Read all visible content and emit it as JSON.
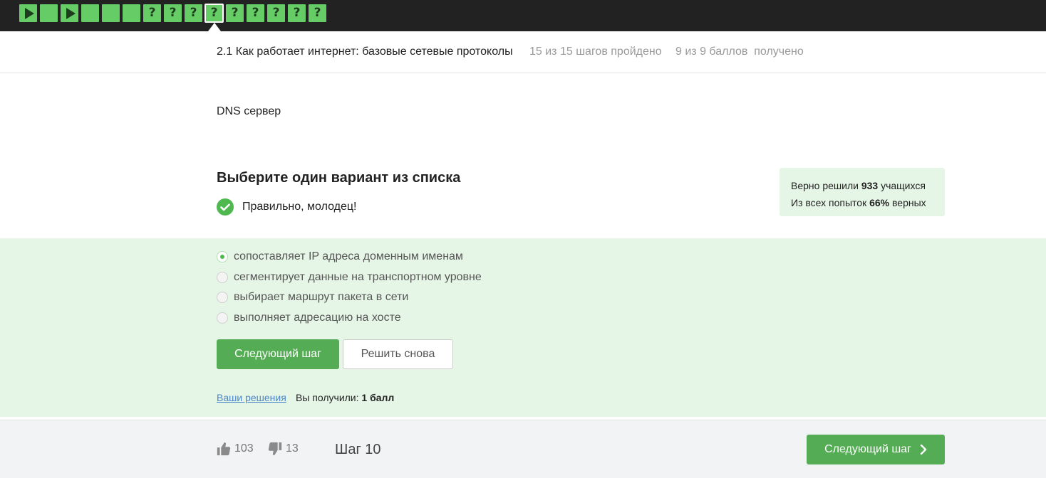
{
  "step_bar": {
    "steps": [
      {
        "type": "video",
        "icon": "play-icon"
      },
      {
        "type": "text"
      },
      {
        "type": "video",
        "icon": "play-icon"
      },
      {
        "type": "text"
      },
      {
        "type": "text"
      },
      {
        "type": "text"
      },
      {
        "type": "quiz",
        "label": "?"
      },
      {
        "type": "quiz",
        "label": "?"
      },
      {
        "type": "quiz",
        "label": "?"
      },
      {
        "type": "quiz",
        "label": "?",
        "current": true
      },
      {
        "type": "quiz",
        "label": "?"
      },
      {
        "type": "quiz",
        "label": "?"
      },
      {
        "type": "quiz",
        "label": "?"
      },
      {
        "type": "quiz",
        "label": "?"
      },
      {
        "type": "quiz",
        "label": "?"
      }
    ],
    "completed_color": "#66cc66"
  },
  "lesson": {
    "title": "2.1 Как работает интернет: базовые сетевые протоколы",
    "steps_progress": "15 из 15 шагов пройдено",
    "points_progress": "9 из 9 баллов  получено"
  },
  "question": {
    "text": "DNS сервер",
    "task_title": "Выберите один вариант из списка",
    "feedback": "Правильно, молодец!",
    "options": [
      {
        "label": "сопоставляет IP адреса доменным именам",
        "checked": true
      },
      {
        "label": "сегментирует данные на транспортном уровне",
        "checked": false
      },
      {
        "label": "выбирает маршрут пакета в сети",
        "checked": false
      },
      {
        "label": "выполняет адресацию на хосте",
        "checked": false
      }
    ]
  },
  "stats": {
    "solved_prefix": "Верно решили ",
    "solved_count": "933",
    "solved_suffix": " учащихся",
    "attempts_prefix": "Из всех попыток ",
    "attempts_percent": "66%",
    "attempts_suffix": " верных"
  },
  "actions": {
    "next_label": "Следующий шаг",
    "retry_label": "Решить снова",
    "solutions_link": "Ваши решения",
    "got_prefix": "Вы получили: ",
    "got_value": "1 балл"
  },
  "footer": {
    "likes": "103",
    "dislikes": "13",
    "step_label": "Шаг 10",
    "next_label": "Следующий шаг"
  },
  "colors": {
    "accent": "#54ad54",
    "answer_bg": "#e6f6e6",
    "link": "#4b86c8"
  }
}
